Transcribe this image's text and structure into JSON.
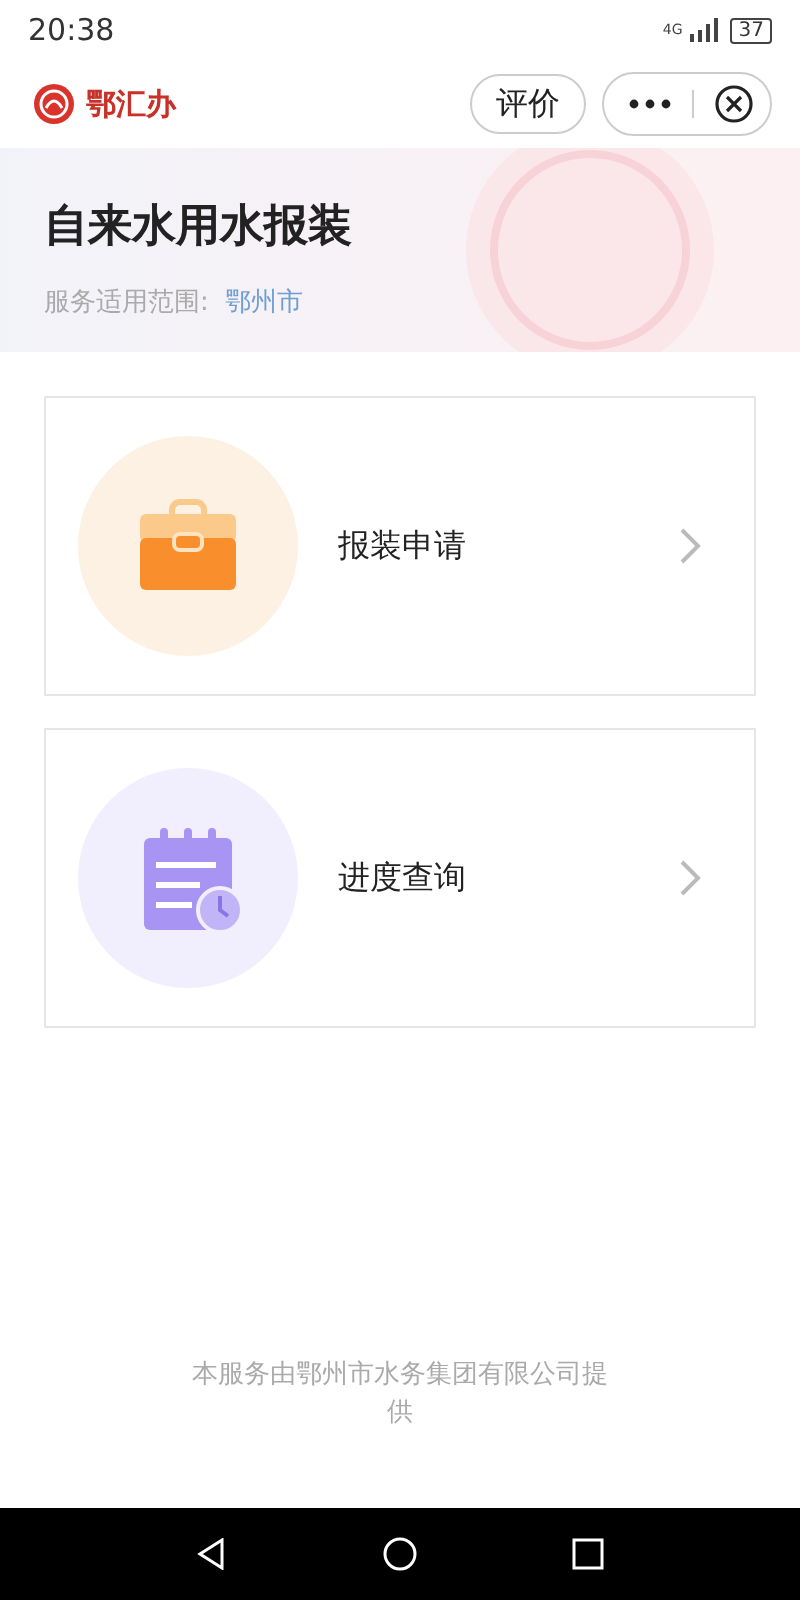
{
  "status_bar": {
    "time": "20:38",
    "network": "4G",
    "battery": "37"
  },
  "nav_bar": {
    "app_name": "鄂汇办",
    "rate_button": "评价"
  },
  "header": {
    "title": "自来水用水报装",
    "scope_label": "服务适用范围:",
    "scope_value": "鄂州市"
  },
  "cards": [
    {
      "kind": "briefcase",
      "label": "报装申请"
    },
    {
      "kind": "calendar",
      "label": "进度查询"
    }
  ],
  "footer": "本服务由鄂州市水务集团有限公司提供"
}
